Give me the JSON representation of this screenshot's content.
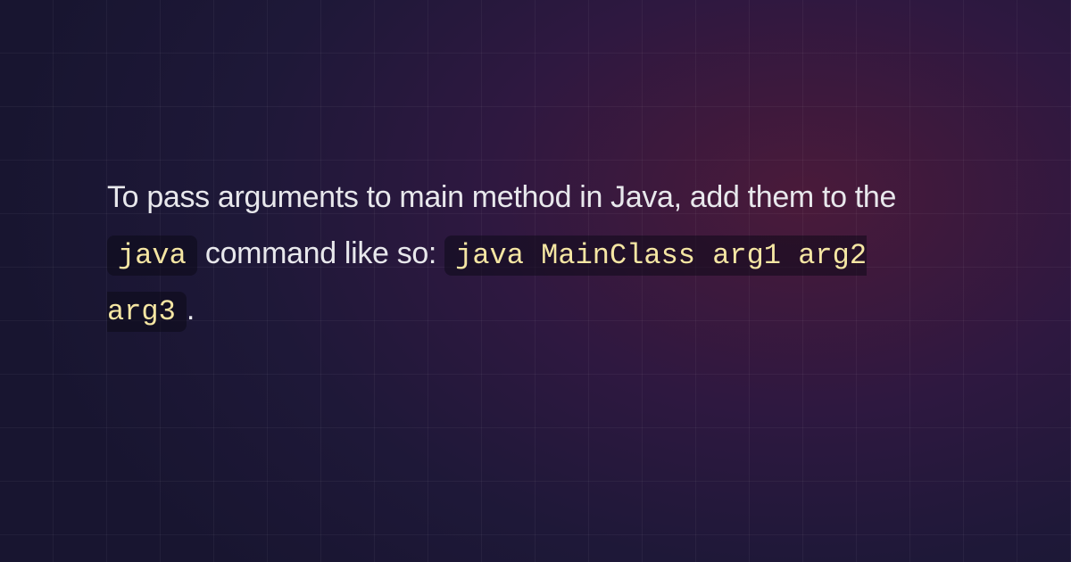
{
  "content": {
    "text_before_code1": "To pass arguments to main method in Java, add them to the ",
    "code1": "java",
    "text_between": " command like so: ",
    "code2": "java MainClass arg1 arg2 arg3",
    "text_after": "."
  }
}
